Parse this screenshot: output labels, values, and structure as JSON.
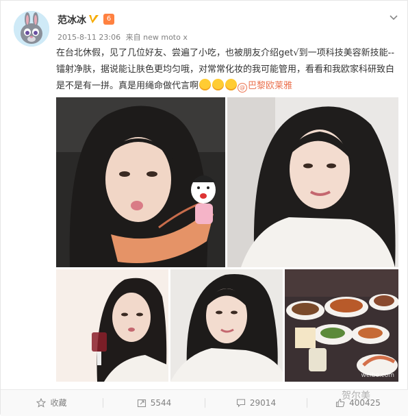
{
  "post": {
    "username": "范冰冰",
    "rank_badge": "6",
    "timestamp": "2015-8-11 23:06",
    "source_prefix": "来自",
    "device": "new moto x",
    "text_part1": "在台北休假，见了几位好友、尝遍了小吃，也被朋友介绍get√到一项科技美容新技能--镭射净肤，据说能让肤色更均匀哦，对常常化妆的我可能管用，看看和我欧家科研致白是不是有一拼。真是用绳命做代言啊",
    "mention": "巴黎欧莱雅",
    "watermark": "weibo.com"
  },
  "actions": {
    "favorite_label": "收藏",
    "repost_count": "5544",
    "comment_count": "29014",
    "like_count": "400425"
  },
  "footer_watermark": "贺尔美",
  "colors": {
    "accent": "#eb7350",
    "verified": "#f6ab00"
  },
  "icons": [
    "avatar-icon",
    "verified-icon",
    "rank-icon",
    "chevron-down-icon",
    "star-icon",
    "repost-icon",
    "comment-icon",
    "like-icon"
  ]
}
